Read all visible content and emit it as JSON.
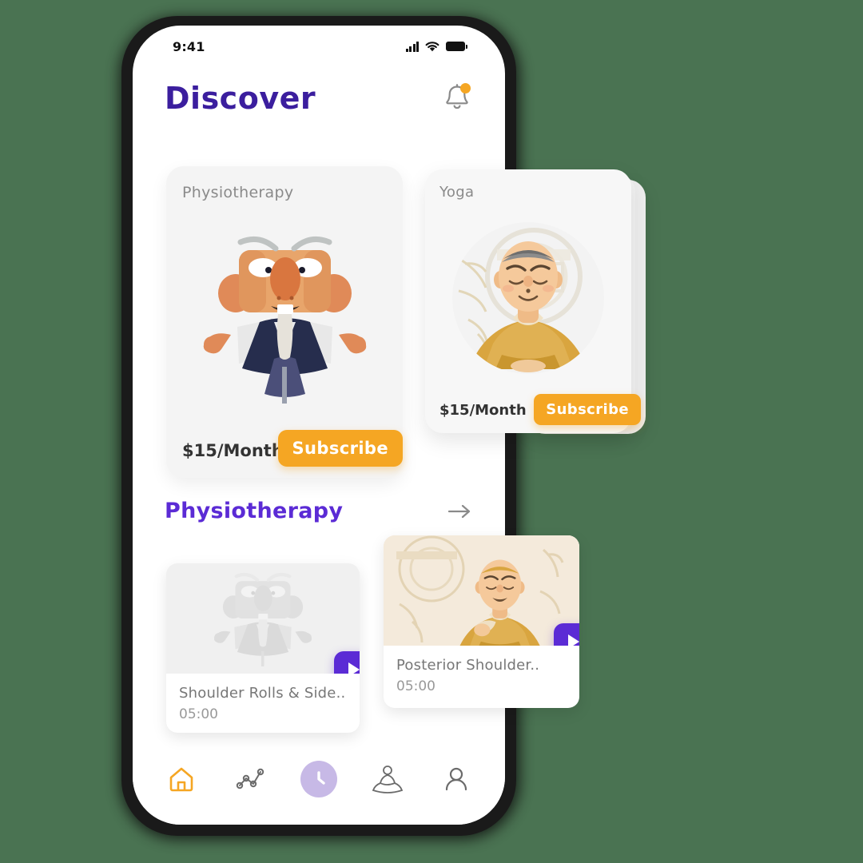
{
  "background_color": "#4A7352",
  "theme": {
    "purple": "#5B2BD5",
    "title_purple": "#3B1E9E",
    "orange": "#F5A623",
    "card_gray": "#F4F4F4",
    "clock_purple": "#C7B9E6"
  },
  "status_bar": {
    "time": "9:41",
    "signal_icon": "signal-bars-icon",
    "wifi_icon": "wifi-icon",
    "battery_icon": "battery-full-icon"
  },
  "header": {
    "title": "Discover",
    "notification_icon": "bell-icon",
    "has_badge": true
  },
  "subscription_cards": [
    {
      "label": "Physiotherapy",
      "price": "$15/Month",
      "button_label": "Subscribe",
      "art": "meditating-master-illustration"
    },
    {
      "label": "Yoga",
      "price": "$15/Month",
      "button_label": "Subscribe",
      "art": "meditating-monk-illustration"
    }
  ],
  "section": {
    "title": "Physiotherapy",
    "arrow_icon": "arrow-right-icon"
  },
  "videos": [
    {
      "title": "Shoulder Rolls & Side..",
      "duration": "05:00",
      "play_icon": "play-icon"
    },
    {
      "title": "Posterior Shoulder..",
      "duration": "05:00",
      "play_icon": "play-icon"
    }
  ],
  "bottom_nav": [
    {
      "name": "home",
      "icon": "home-icon",
      "active": true
    },
    {
      "name": "stats",
      "icon": "line-chart-icon",
      "active": false
    },
    {
      "name": "history",
      "icon": "clock-icon",
      "active": true
    },
    {
      "name": "meditation",
      "icon": "meditation-icon",
      "active": false
    },
    {
      "name": "profile",
      "icon": "user-icon",
      "active": false
    }
  ]
}
